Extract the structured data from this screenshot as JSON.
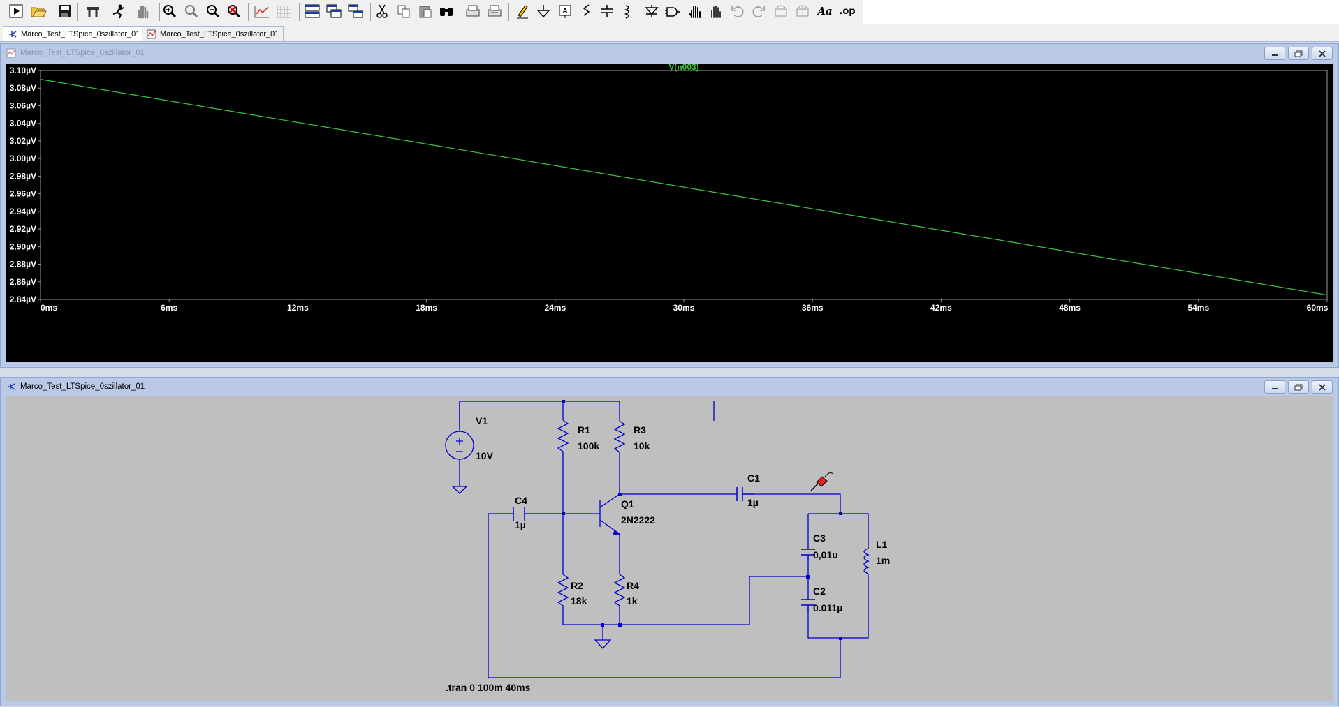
{
  "toolbar": {
    "buttons": [
      "run-icon",
      "open-icon",
      "save-icon",
      "control-panel-icon",
      "halt-icon",
      "pan-icon",
      "zoom-in-icon",
      "zoom-area-icon",
      "zoom-out-icon",
      "zoom-fit-icon",
      "autorange-icon",
      "grid-icon",
      "tile-horizontal-icon",
      "cascade-icon",
      "tile-vertical-icon",
      "cut-icon",
      "copy-icon",
      "paste-icon",
      "find-icon",
      "print-preview-icon",
      "print-icon",
      "draw-wire-icon",
      "ground-icon",
      "label-net-icon",
      "resistor-icon",
      "capacitor-icon",
      "inductor-icon",
      "diode-icon",
      "component-icon",
      "move-icon",
      "drag-icon",
      "undo-icon",
      "redo-icon",
      "rotate-icon",
      "mirror-icon",
      "text-icon",
      "spice-directive-icon"
    ],
    "text_label": "Aa",
    "spice_label": ".op"
  },
  "tabs": [
    {
      "label": "Marco_Test_LTSpice_0szillator_01",
      "kind": "schematic"
    },
    {
      "label": "Marco_Test_LTSpice_0szillator_01",
      "kind": "waveform"
    }
  ],
  "waveform_window": {
    "title": "Marco_Test_LTSpice_0szillator_01"
  },
  "schematic_window": {
    "title": "Marco_Test_LTSpice_0szillator_01",
    "components": {
      "V1": {
        "name": "V1",
        "value": "10V"
      },
      "R1": {
        "name": "R1",
        "value": "100k"
      },
      "R3": {
        "name": "R3",
        "value": "10k"
      },
      "C4": {
        "name": "C4",
        "value": "1µ"
      },
      "Q1": {
        "name": "Q1",
        "value": "2N2222"
      },
      "C1": {
        "name": "C1",
        "value": "1µ"
      },
      "C3": {
        "name": "C3",
        "value": "0,01u"
      },
      "L1": {
        "name": "L1",
        "value": "1m"
      },
      "C2": {
        "name": "C2",
        "value": "0.011µ"
      },
      "R2": {
        "name": "R2",
        "value": "18k"
      },
      "R4": {
        "name": "R4",
        "value": "1k"
      }
    },
    "directive": ".tran 0 100m 40ms"
  },
  "chart_data": {
    "type": "line",
    "title": "V(n003)",
    "series": [
      {
        "name": "V(n003)",
        "color": "#3ec43e",
        "x": [
          0,
          60
        ],
        "y": [
          3.09,
          2.845
        ]
      }
    ],
    "xlabel": "",
    "ylabel": "",
    "xlim": [
      0,
      60
    ],
    "ylim": [
      2.84,
      3.1
    ],
    "x_ticks": [
      "0ms",
      "6ms",
      "12ms",
      "18ms",
      "24ms",
      "30ms",
      "36ms",
      "42ms",
      "48ms",
      "54ms",
      "60ms"
    ],
    "y_ticks": [
      "3.10µV",
      "3.08µV",
      "3.06µV",
      "3.04µV",
      "3.02µV",
      "3.00µV",
      "2.98µV",
      "2.96µV",
      "2.94µV",
      "2.92µV",
      "2.90µV",
      "2.88µV",
      "2.86µV",
      "2.84µV"
    ],
    "grid": false,
    "axis_color": "#9a9a9a",
    "label_color": "#ffffff",
    "trace_color": "#3ec43e"
  }
}
